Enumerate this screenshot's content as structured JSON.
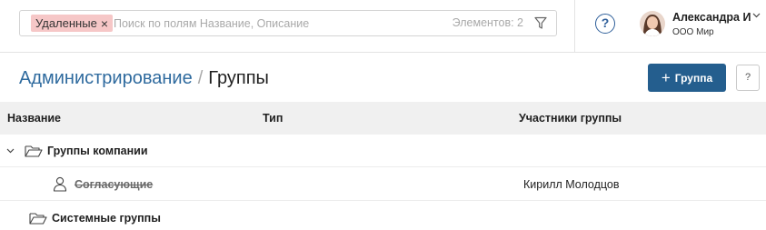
{
  "search": {
    "filter_chip": "Удаленные",
    "placeholder": "Поиск по полям Название, Описание",
    "count": "Элементов: 2"
  },
  "user": {
    "name": "Александра И",
    "org": "ООО Мир"
  },
  "header": {
    "breadcrumb_root": "Администрирование",
    "breadcrumb_separator": "/",
    "title": "Группы",
    "add_button": "Группа",
    "help_button": "?"
  },
  "table": {
    "columns": [
      "Название",
      "Тип",
      "Участники группы"
    ],
    "rows": [
      {
        "name": "Группы компании",
        "type": "",
        "members": ""
      },
      {
        "name": "Согласующие",
        "type": "",
        "members": "Кирилл Молодцов"
      },
      {
        "name": "Системные группы",
        "type": "",
        "members": ""
      }
    ]
  },
  "colors": {
    "accent": "#245e8e",
    "breadcrumb_link": "#2e6a9e",
    "chip_background": "#f6c7c7"
  }
}
